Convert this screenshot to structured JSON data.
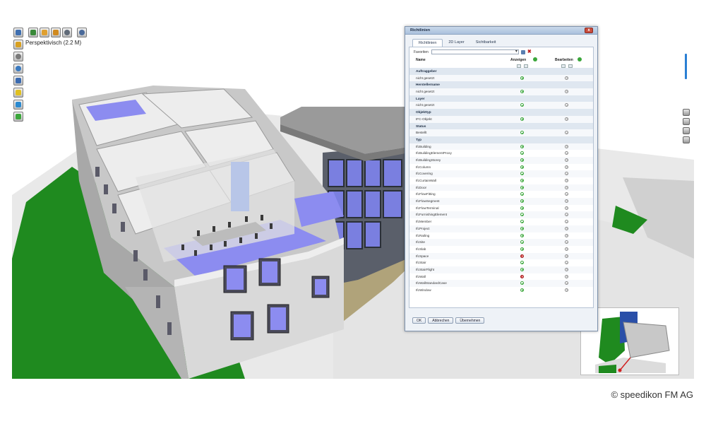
{
  "viewport": {
    "view_label": "Perspektivisch (2.2 M)"
  },
  "toolbar_top": {
    "buttons": [
      {
        "icon": "save-icon",
        "color": "#3f6fb0"
      },
      {
        "icon": "layers-icon",
        "color": "#3a8a3a"
      },
      {
        "icon": "edit-icon",
        "color": "#e0a030"
      },
      {
        "icon": "folder-icon",
        "color": "#d08a20"
      },
      {
        "icon": "search-icon",
        "color": "#606a78"
      },
      {
        "icon": "settings-icon",
        "color": "#4a6a9a"
      }
    ]
  },
  "toolbar_left": {
    "buttons": [
      {
        "icon": "pencil-icon",
        "color": "#d8a020"
      },
      {
        "icon": "rotate-icon",
        "color": "#7a7a7a"
      },
      {
        "icon": "eye-icon",
        "color": "#3a7ac0"
      },
      {
        "icon": "building-icon",
        "color": "#3a6ab0"
      },
      {
        "icon": "note-icon",
        "color": "#e0c020"
      },
      {
        "icon": "floors-icon",
        "color": "#2a8ad0"
      },
      {
        "icon": "stack-icon",
        "color": "#3aa63a"
      }
    ]
  },
  "dialog": {
    "title": "Richtlinien",
    "close_label": "x",
    "tabs": [
      "Richtlinien",
      "2D Layer",
      "Sichtbarkeit"
    ],
    "favorites_label": "Favoriten",
    "columns": {
      "name": "Name",
      "show": "Anzeigen",
      "edit": "Bearbeiten"
    },
    "groups": [
      {
        "title": "Auftraggeber",
        "rows": [
          {
            "label": "nicht gesetzt",
            "show": "on",
            "edit": "off"
          }
        ]
      },
      {
        "title": "Herstellername",
        "rows": [
          {
            "label": "nicht gesetzt",
            "show": "on",
            "edit": "off"
          }
        ]
      },
      {
        "title": "Layer",
        "rows": [
          {
            "label": "nicht gesetzt",
            "show": "on",
            "edit": "off"
          }
        ]
      },
      {
        "title": "Objekttyp",
        "rows": [
          {
            "label": "IFC-Objekt",
            "show": "on",
            "edit": "off"
          }
        ]
      },
      {
        "title": "Status",
        "rows": [
          {
            "label": "Bestellt",
            "show": "on",
            "edit": "off"
          }
        ]
      },
      {
        "title": "Typ",
        "rows": [
          {
            "label": "IfcBuilding",
            "show": "on",
            "edit": "off"
          },
          {
            "label": "IfcBuildingElementProxy",
            "show": "on",
            "edit": "off"
          },
          {
            "label": "IfcBuildingStorey",
            "show": "on",
            "edit": "off"
          },
          {
            "label": "IfcColumn",
            "show": "on",
            "edit": "off"
          },
          {
            "label": "IfcCovering",
            "show": "on",
            "edit": "off"
          },
          {
            "label": "IfcCurtainWall",
            "show": "on",
            "edit": "off"
          },
          {
            "label": "IfcDoor",
            "show": "on",
            "edit": "off"
          },
          {
            "label": "IfcFlowFitting",
            "show": "on",
            "edit": "off"
          },
          {
            "label": "IfcFlowSegment",
            "show": "on",
            "edit": "off"
          },
          {
            "label": "IfcFlowTerminal",
            "show": "on",
            "edit": "off"
          },
          {
            "label": "IfcFurnishingElement",
            "show": "on",
            "edit": "off"
          },
          {
            "label": "IfcMember",
            "show": "on",
            "edit": "off"
          },
          {
            "label": "IfcProject",
            "show": "on",
            "edit": "off"
          },
          {
            "label": "IfcRailing",
            "show": "on",
            "edit": "off"
          },
          {
            "label": "IfcSite",
            "show": "on",
            "edit": "off"
          },
          {
            "label": "IfcSlab",
            "show": "on",
            "edit": "off"
          },
          {
            "label": "IfcSpace",
            "show": "deny",
            "edit": "off"
          },
          {
            "label": "IfcStair",
            "show": "on",
            "edit": "off"
          },
          {
            "label": "IfcStairFlight",
            "show": "on",
            "edit": "off"
          },
          {
            "label": "IfcWall",
            "show": "deny",
            "edit": "off"
          },
          {
            "label": "IfcWallStandardCase",
            "show": "on",
            "edit": "off"
          },
          {
            "label": "IfcWindow",
            "show": "on",
            "edit": "off"
          }
        ]
      }
    ],
    "buttons": {
      "ok": "OK",
      "cancel": "Abbrechen",
      "apply": "Übernehmen"
    }
  },
  "footer": {
    "copyright": "© speedikon FM AG"
  },
  "colors": {
    "grass": "#1f8a1f",
    "floor": "#8c8cf0",
    "wall": "#d6d6d6",
    "accent": "#2a7fd4"
  }
}
